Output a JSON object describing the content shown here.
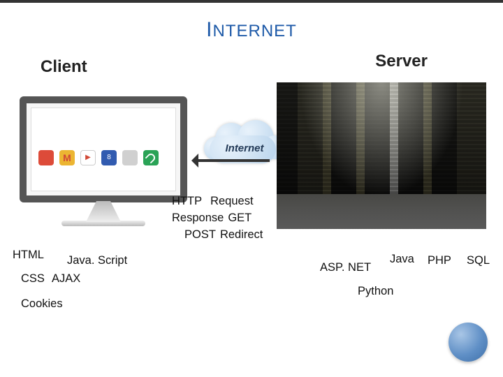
{
  "title_big_first": "I",
  "title_small_rest": "NTERNET",
  "client_label": "Client",
  "server_label": "Server",
  "cloud_label": "Internet",
  "http": {
    "l1a": "HTTP",
    "l1b": "Request",
    "l2a": "Response",
    "l2b": "GET",
    "l3a": "POST",
    "l3b": "Redirect"
  },
  "client_tech": {
    "html": "HTML",
    "js": "Java. Script",
    "css": "CSS",
    "ajax": "AJAX",
    "cookies": "Cookies"
  },
  "server_tech": {
    "asp": "ASP. NET",
    "java": "Java",
    "php": "PHP",
    "sql": "SQL",
    "python": "Python"
  },
  "browser_icon_blue_text": "8"
}
